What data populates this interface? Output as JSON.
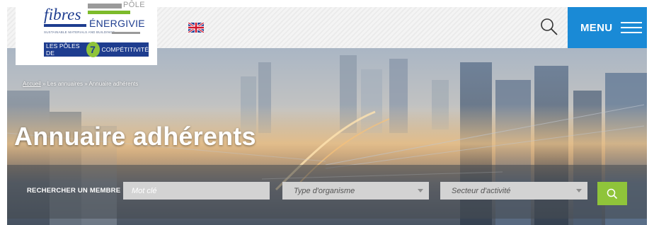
{
  "logo": {
    "fibres": "fibres",
    "pole": "PÔLE",
    "energivie": "ÉNERGIVIE",
    "tagline": "SUSTAINABLE MATERIALS AND BUILDINGS",
    "poles_left": "LES PÔLES DE",
    "poles_mark": "7",
    "poles_right": "COMPÉTITIVITÉ"
  },
  "header": {
    "language_icon": "uk-flag-icon",
    "search_icon": "search-icon",
    "menu_label": "MENU",
    "menu_icon": "hamburger-icon",
    "menu_color": "#1a8ad6"
  },
  "breadcrumb": {
    "home": "Accueil",
    "separator": "»",
    "level1": "Les annuaires",
    "current": "Annuaire adhérents"
  },
  "page": {
    "title": "Annuaire adhérents"
  },
  "search": {
    "label": "RECHERCHER UN MEMBRE :",
    "keyword_placeholder": "Mot clé",
    "organisation_type": "Type d'organisme",
    "activity_sector": "Secteur d'activité",
    "submit_icon": "search-icon",
    "submit_color": "#8fc43a"
  }
}
